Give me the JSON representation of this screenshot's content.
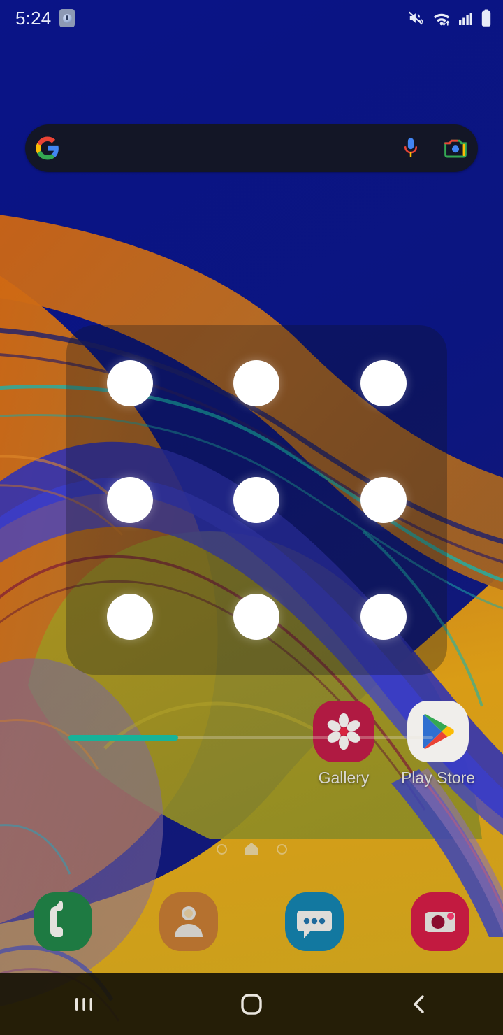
{
  "status_bar": {
    "time": "5:24",
    "notification_icon": "app-notification-icon",
    "icons": [
      {
        "name": "sound-mute-vibrate-icon"
      },
      {
        "name": "wifi-icon"
      },
      {
        "name": "cellular-signal-icon"
      },
      {
        "name": "battery-icon"
      }
    ]
  },
  "search": {
    "placeholder": "",
    "value": "",
    "logo": "google-g-logo",
    "mic_icon": "microphone-icon",
    "lens_icon": "google-lens-camera-icon"
  },
  "pattern_lock": {
    "dots": [
      {
        "id": "dot-1",
        "row": 1,
        "col": 1,
        "selected": false
      },
      {
        "id": "dot-2",
        "row": 1,
        "col": 2,
        "selected": false
      },
      {
        "id": "dot-3",
        "row": 1,
        "col": 3,
        "selected": false
      },
      {
        "id": "dot-4",
        "row": 2,
        "col": 1,
        "selected": false
      },
      {
        "id": "dot-5",
        "row": 2,
        "col": 2,
        "selected": false
      },
      {
        "id": "dot-6",
        "row": 2,
        "col": 3,
        "selected": false
      },
      {
        "id": "dot-7",
        "row": 3,
        "col": 1,
        "selected": false
      },
      {
        "id": "dot-8",
        "row": 3,
        "col": 2,
        "selected": false
      },
      {
        "id": "dot-9",
        "row": 3,
        "col": 3,
        "selected": false
      }
    ]
  },
  "progress_bar": {
    "fill_percent": 30,
    "fill_color": "#16b39a",
    "track_color": "#ebe6d7"
  },
  "home_apps": [
    {
      "label": "Gallery",
      "icon": "gallery-icon",
      "color": "#b01a42"
    },
    {
      "label": "Play Store",
      "icon": "play-store-icon",
      "color": "#f0eeeb"
    }
  ],
  "page_indicator": {
    "pages": 3,
    "current": 2,
    "home_page_index": 2
  },
  "dock": [
    {
      "label": "Phone",
      "icon": "phone-icon",
      "color": "#1e7a42"
    },
    {
      "label": "Contacts",
      "icon": "contacts-icon",
      "color": "#b5712f"
    },
    {
      "label": "Messages",
      "icon": "messages-icon",
      "color": "#1278a0"
    },
    {
      "label": "Camera",
      "icon": "camera-icon",
      "color": "#c21a40"
    }
  ],
  "nav_bar": {
    "buttons": [
      {
        "name": "recents-button",
        "icon": "recents-icon"
      },
      {
        "name": "home-button",
        "icon": "home-icon"
      },
      {
        "name": "back-button",
        "icon": "back-chevron-icon"
      }
    ]
  },
  "theme": {
    "wallpaper_top": "#0a1583",
    "wallpaper_bottom": "#d69b11",
    "accent_teal": "#16b39a",
    "status_text": "#e8ecf8"
  }
}
